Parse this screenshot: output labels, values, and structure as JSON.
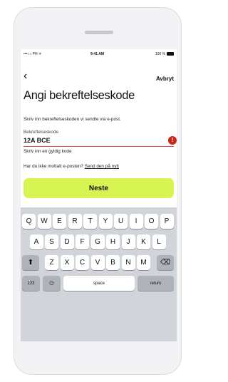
{
  "status_bar": {
    "carrier": "•••○○ PH ᯤ",
    "time": "9:41 AM",
    "battery": "100 %"
  },
  "nav": {
    "back_symbol": "‹",
    "cancel_label": "Avbryt"
  },
  "page": {
    "title": "Angi bekreftelseskode",
    "instruction": "Skriv inn bekreftelseskoden vi sendte via e-post."
  },
  "code_field": {
    "label": "Bekreftelseskode",
    "value": "12A BCE",
    "error_icon_symbol": "!",
    "error_message": "Skriv inn en gyldig kode",
    "error_color": "#c9241a"
  },
  "resend": {
    "prompt": "Har du ikke mottatt e-posten?",
    "link": "Send den på nytt"
  },
  "primary_button": {
    "label": "Neste",
    "color": "#d8f452"
  },
  "keyboard": {
    "row1": [
      "Q",
      "W",
      "E",
      "R",
      "T",
      "Y",
      "U",
      "I",
      "O",
      "P"
    ],
    "row2": [
      "A",
      "S",
      "D",
      "F",
      "G",
      "H",
      "J",
      "K",
      "L"
    ],
    "row3": [
      "Z",
      "X",
      "C",
      "V",
      "B",
      "N",
      "M"
    ],
    "shift_symbol": "⬆",
    "backspace_symbol": "⌫",
    "numbers_label": "123",
    "emoji_symbol": "☺",
    "space_label": "space",
    "return_label": "return"
  }
}
